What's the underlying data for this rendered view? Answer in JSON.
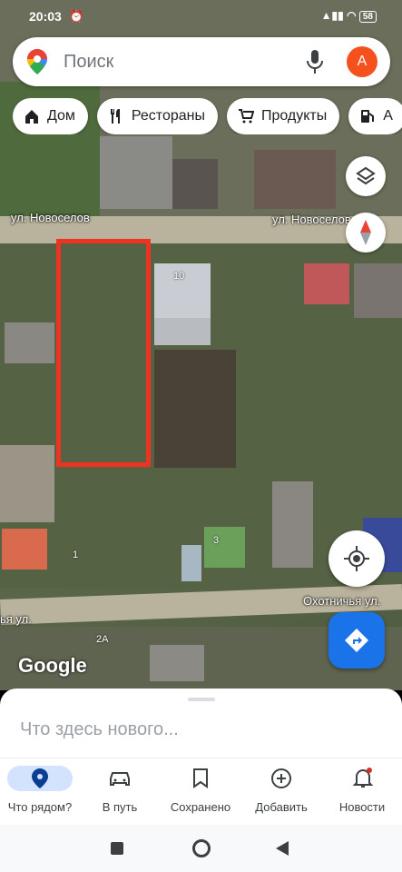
{
  "status_bar": {
    "time": "20:03",
    "battery": "58"
  },
  "search": {
    "placeholder": "Поиск",
    "avatar_letter": "А"
  },
  "chips": [
    {
      "label": "Дом"
    },
    {
      "label": "Рестораны"
    },
    {
      "label": "Продукты"
    },
    {
      "label": "А"
    }
  ],
  "map": {
    "street_1_left": "ул. Новоселов",
    "street_1_right": "ул. Новоселов",
    "street_2_right": "Охотничья ул.",
    "street_2_left": "ья ул.",
    "house_10": "10",
    "house_1": "1",
    "house_3": "3",
    "house_2a": "2А",
    "logo": "Google"
  },
  "sheet": {
    "title": "Что здесь нового..."
  },
  "bottom_nav": [
    {
      "label": "Что рядом?",
      "icon": "location-pin-icon",
      "active": true
    },
    {
      "label": "В путь",
      "icon": "car-icon"
    },
    {
      "label": "Сохранено",
      "icon": "bookmark-icon"
    },
    {
      "label": "Добавить",
      "icon": "add-circle-icon"
    },
    {
      "label": "Новости",
      "icon": "bell-icon"
    }
  ],
  "colors": {
    "accent": "#1a73e8",
    "highlight": "#ee3322",
    "avatar": "#f4511e"
  }
}
